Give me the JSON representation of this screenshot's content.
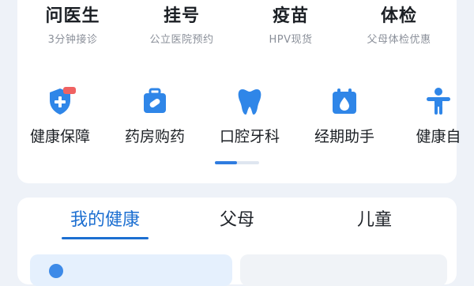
{
  "services": [
    {
      "title": "问医生",
      "subtitle": "3分钟接诊"
    },
    {
      "title": "挂号",
      "subtitle": "公立医院预约"
    },
    {
      "title": "疫苗",
      "subtitle": "HPV现货"
    },
    {
      "title": "体检",
      "subtitle": "父母体检优惠"
    }
  ],
  "quick_entries": [
    {
      "label": "健康保障",
      "icon": "shield-plus-icon"
    },
    {
      "label": "药房购药",
      "icon": "medicine-kit-icon"
    },
    {
      "label": "口腔牙科",
      "icon": "tooth-icon"
    },
    {
      "label": "经期助手",
      "icon": "calendar-drop-icon"
    },
    {
      "label": "健康自",
      "icon": "person-icon"
    }
  ],
  "pager": {
    "position": 0.5
  },
  "tabs": [
    {
      "label": "我的健康",
      "active": true
    },
    {
      "label": "父母",
      "active": false
    },
    {
      "label": "儿童",
      "active": false
    }
  ],
  "colors": {
    "accent": "#1c6fd1",
    "icon_blue": "#2f86e8",
    "badge_red": "#f06262"
  }
}
